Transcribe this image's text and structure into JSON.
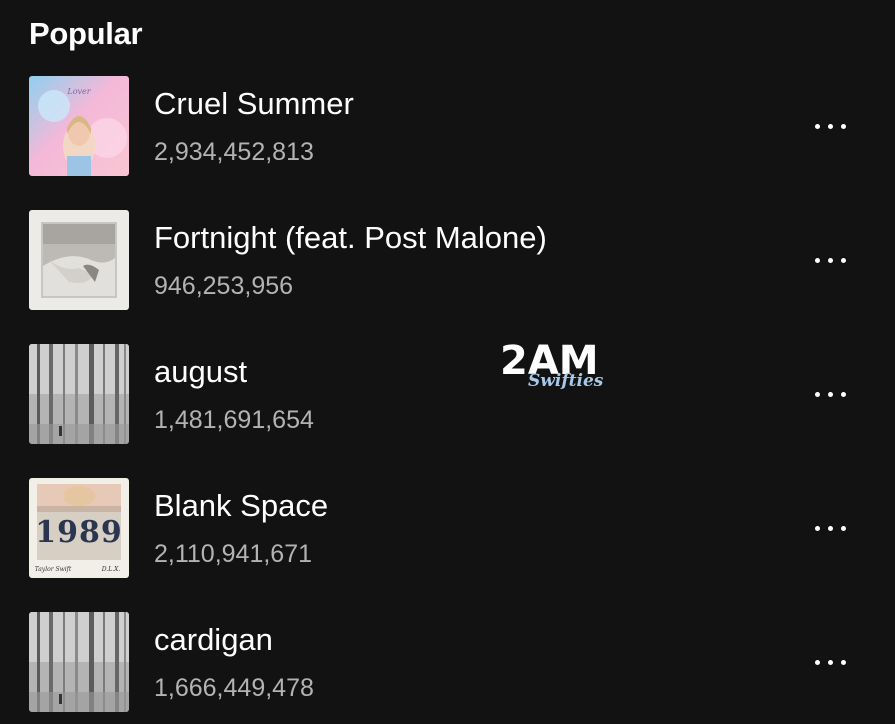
{
  "section": {
    "title": "Popular"
  },
  "tracks": [
    {
      "title": "Cruel Summer",
      "plays": "2,934,452,813",
      "cover": "lover-album-cover"
    },
    {
      "title": "Fortnight (feat. Post Malone)",
      "plays": "946,253,956",
      "cover": "ttpd-album-cover"
    },
    {
      "title": "august",
      "plays": "1,481,691,654",
      "cover": "folklore-album-cover"
    },
    {
      "title": "Blank Space",
      "plays": "2,110,941,671",
      "cover": "1989-album-cover"
    },
    {
      "title": "cardigan",
      "plays": "1,666,449,478",
      "cover": "folklore-album-cover"
    }
  ],
  "covers": {
    "lover_script": "Lover",
    "1989_title": "1989",
    "1989_signature": "Taylor Swift",
    "1989_edition": "D.L.X."
  },
  "watermark": {
    "line1": "2AM",
    "line2": "Swifties"
  },
  "icons": {
    "more": "more-horizontal-icon"
  },
  "colors": {
    "background": "#121212",
    "primary_text": "#ffffff",
    "secondary_text": "#b3b3b3"
  }
}
